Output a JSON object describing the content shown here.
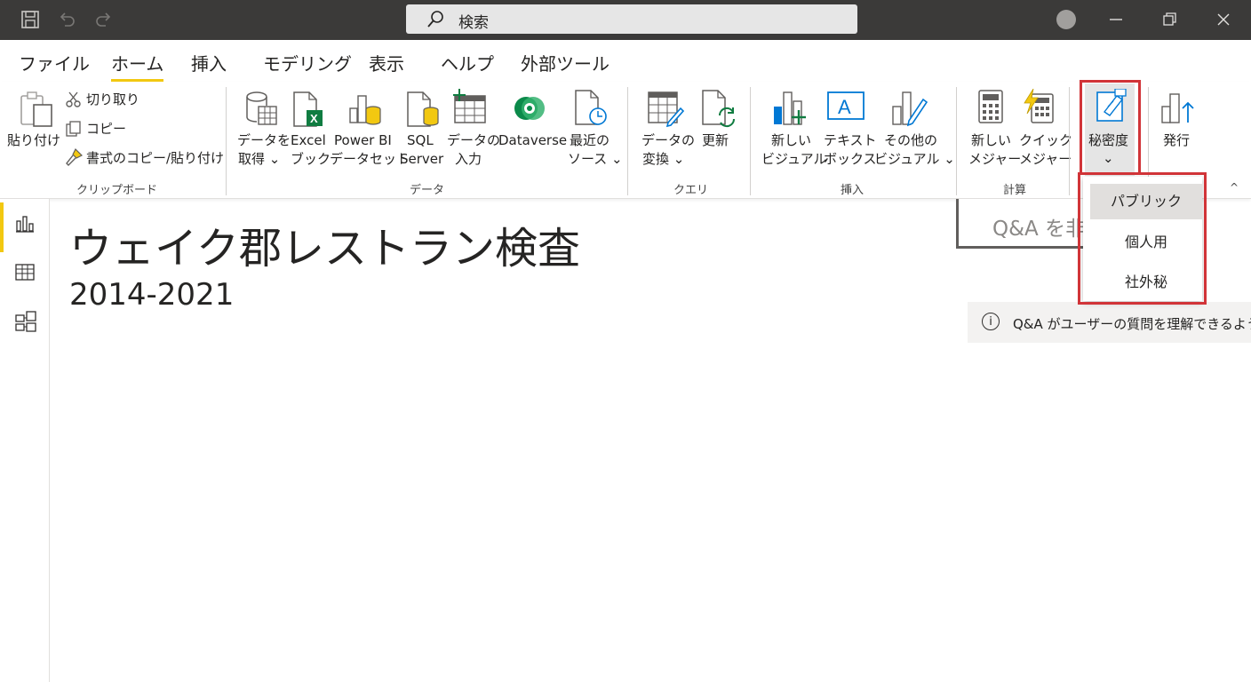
{
  "titlebar": {
    "search_placeholder": "検索",
    "icons": [
      "save-icon",
      "undo-icon",
      "redo-icon",
      "search-icon",
      "minimize-icon",
      "restore-icon",
      "close-icon"
    ]
  },
  "tabs": [
    {
      "label": "ファイル"
    },
    {
      "label": "ホーム",
      "active": true
    },
    {
      "label": "挿入"
    },
    {
      "label": "モデリング"
    },
    {
      "label": "表示"
    },
    {
      "label": "ヘルプ"
    },
    {
      "label": "外部ツール"
    }
  ],
  "ribbon": {
    "clipboard": {
      "paste": "貼り付け",
      "cut": "切り取り",
      "copy": "コピー",
      "format_painter": "書式のコピー/貼り付け",
      "group": "クリップボード"
    },
    "data": {
      "get_data": [
        "データを",
        "取得 ⌄"
      ],
      "excel": [
        "Excel",
        "ブック"
      ],
      "pbi_dataset": [
        "Power BI",
        "データセット"
      ],
      "sql": [
        "SQL",
        "Server"
      ],
      "enter_data": [
        "データの",
        "入力"
      ],
      "dataverse": "Dataverse",
      "recent": [
        "最近の",
        "ソース ⌄"
      ],
      "group": "データ"
    },
    "query": {
      "transform": [
        "データの",
        "変換 ⌄"
      ],
      "refresh": "更新",
      "group": "クエリ"
    },
    "insert": {
      "new_visual": [
        "新しい",
        "ビジュアル"
      ],
      "text_box": [
        "テキスト",
        "ボックス"
      ],
      "more_visuals": [
        "その他の",
        "ビジュアル ⌄"
      ],
      "group": "挿入"
    },
    "calc": {
      "new_measure": [
        "新しい",
        "メジャー"
      ],
      "quick_measure": [
        "クイック",
        "メジャー"
      ],
      "group": "計算"
    },
    "sensitivity": {
      "label": "秘密度",
      "chevron": "⌄"
    },
    "publish": {
      "label": "発行"
    },
    "collapse": "^"
  },
  "sensitivity_menu": [
    "パブリック",
    "個人用",
    "社外秘"
  ],
  "canvas": {
    "title": "ウェイク郡レストラン検査",
    "subtitle": "2014-2021"
  },
  "qa": {
    "placeholder": "Q&A を非",
    "info": "Q&A がユーザーの質問を理解できるように"
  },
  "colors": {
    "accent": "#f2c811",
    "highlight": "#d13438",
    "titlebar": "#3b3a39"
  }
}
